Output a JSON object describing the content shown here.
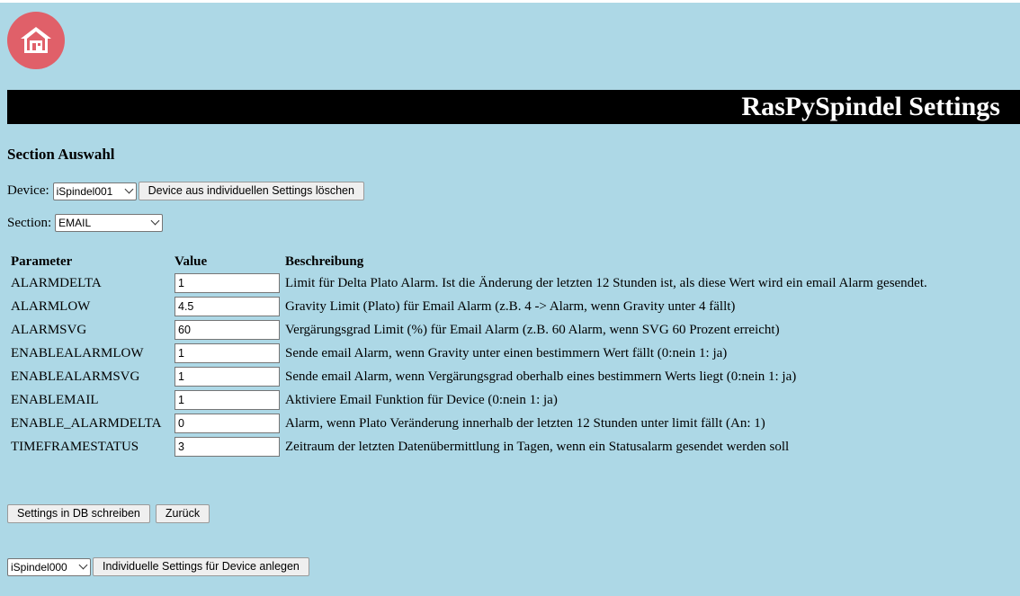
{
  "colors": {
    "page_background": "#add8e6",
    "home_button": "#e06069",
    "title_bar": "#000000",
    "title_text": "#ffffff"
  },
  "home": {
    "icon": "home-icon"
  },
  "header": {
    "title": "RasPySpindel Settings"
  },
  "section_selection": {
    "heading": "Section Auswahl",
    "device_label": "Device:",
    "device_value": "iSpindel001",
    "delete_button": "Device aus individuellen Settings löschen",
    "section_label": "Section:",
    "section_value": "EMAIL"
  },
  "table": {
    "headers": [
      "Parameter",
      "Value",
      "Beschreibung"
    ],
    "rows": [
      {
        "parameter": "ALARMDELTA",
        "value": "1",
        "description": "Limit für Delta Plato Alarm. Ist die Änderung der letzten 12 Stunden ist, als diese Wert wird ein email Alarm gesendet."
      },
      {
        "parameter": "ALARMLOW",
        "value": "4.5",
        "description": "Gravity Limit (Plato) für Email Alarm (z.B. 4 -> Alarm, wenn Gravity unter 4 fällt)"
      },
      {
        "parameter": "ALARMSVG",
        "value": "60",
        "description": "Vergärungsgrad Limit (%) für Email Alarm (z.B. 60 Alarm, wenn SVG 60 Prozent erreicht)"
      },
      {
        "parameter": "ENABLEALARMLOW",
        "value": "1",
        "description": "Sende email Alarm, wenn Gravity unter einen bestimmern Wert fällt (0:nein 1: ja)"
      },
      {
        "parameter": "ENABLEALARMSVG",
        "value": "1",
        "description": "Sende email Alarm, wenn Vergärungsgrad oberhalb eines bestimmern Werts liegt (0:nein 1: ja)"
      },
      {
        "parameter": "ENABLEMAIL",
        "value": "1",
        "description": "Aktiviere Email Funktion für Device (0:nein 1: ja)"
      },
      {
        "parameter": "ENABLE_ALARMDELTA",
        "value": "0",
        "description": "Alarm, wenn Plato Veränderung innerhalb der letzten 12 Stunden unter limit fällt (An: 1)"
      },
      {
        "parameter": "TIMEFRAMESTATUS",
        "value": "3",
        "description": "Zeitraum der letzten Datenübermittlung in Tagen, wenn ein Statusalarm gesendet werden soll"
      }
    ]
  },
  "actions": {
    "save_button": "Settings in DB schreiben",
    "back_button": "Zurück"
  },
  "create": {
    "device_value": "iSpindel000",
    "create_button": "Individuelle Settings für Device anlegen"
  }
}
